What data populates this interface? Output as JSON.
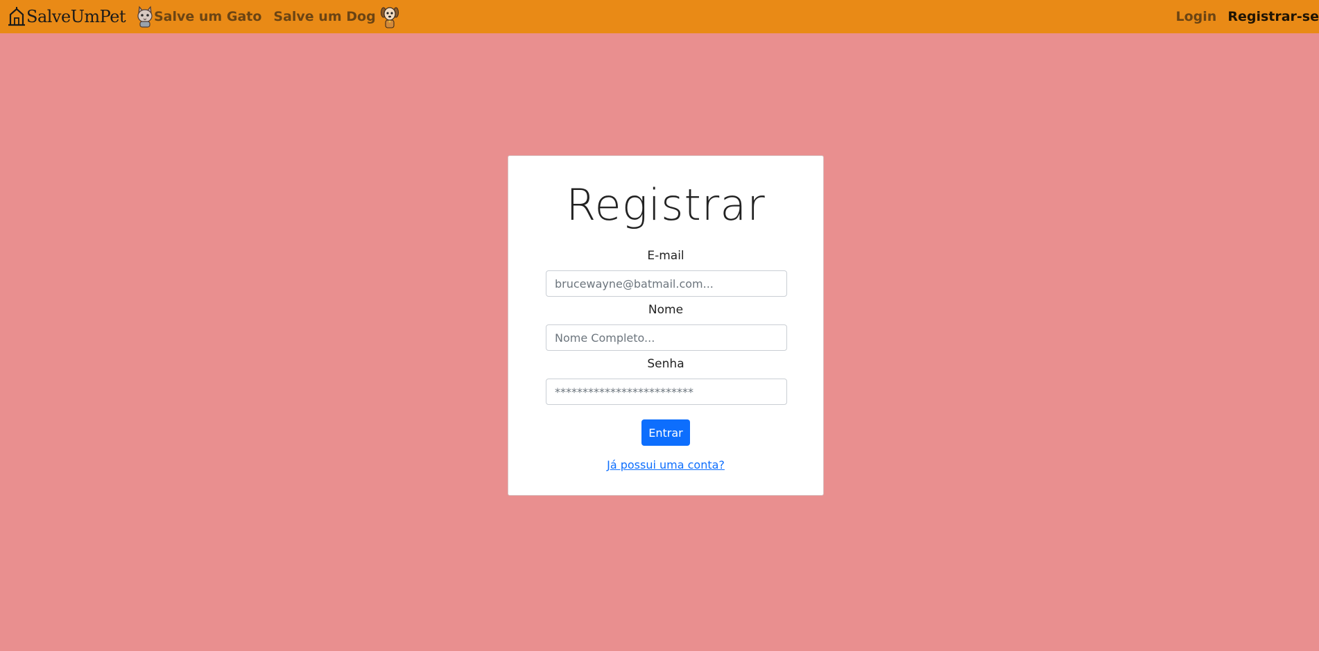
{
  "navbar": {
    "brand_icon": "house-icon",
    "brand": "SalveUmPet",
    "links": [
      {
        "label": "Salve um Gato",
        "icon": "cat-icon"
      },
      {
        "label": "Salve um Dog",
        "icon": "dog-icon"
      }
    ],
    "login": "Login",
    "register": "Registrar-se"
  },
  "form": {
    "title": "Registrar",
    "email_label": "E-mail",
    "email_placeholder": "brucewayne@batmail.com...",
    "name_label": "Nome",
    "name_placeholder": "Nome Completo...",
    "password_label": "Senha",
    "password_placeholder": "*************************",
    "submit": "Entrar",
    "have_account": "Já possui uma conta?"
  },
  "colors": {
    "page_background": "#e98f8f",
    "navbar": "#e98a16",
    "primary": "#0d6efd"
  }
}
